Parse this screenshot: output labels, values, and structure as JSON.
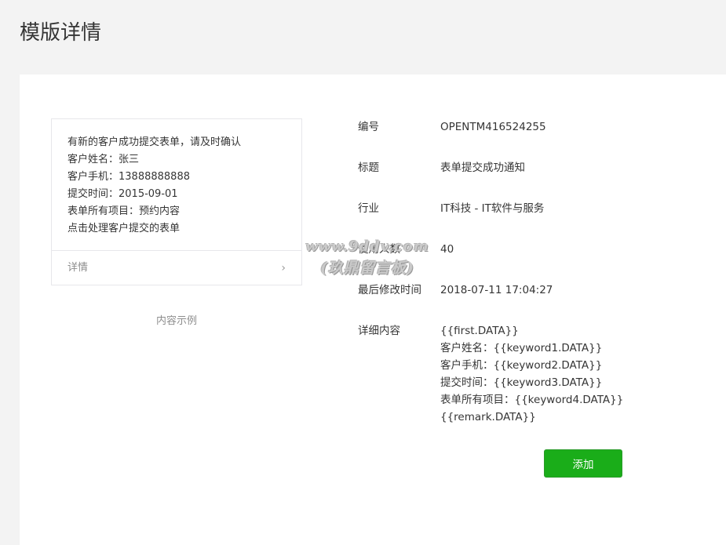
{
  "page": {
    "title": "模版详情"
  },
  "preview": {
    "lines": [
      "有新的客户成功提交表单，请及时确认",
      "客户姓名：张三",
      "客户手机：13888888888",
      "提交时间：2015-09-01",
      "表单所有项目：预约内容",
      "点击处理客户提交的表单"
    ],
    "footer_label": "详情",
    "footer_chevron": "›",
    "caption": "内容示例"
  },
  "info": {
    "id_label": "编号",
    "id_value": "OPENTM416524255",
    "title_label": "标题",
    "title_value": "表单提交成功通知",
    "industry_label": "行业",
    "industry_value": "IT科技 - IT软件与服务",
    "users_label": "使用人数",
    "users_value": "40",
    "modified_label": "最后修改时间",
    "modified_value": "2018-07-11 17:04:27",
    "detail_label": "详细内容",
    "detail_lines": [
      "{{first.DATA}}",
      "客户姓名：{{keyword1.DATA}}",
      "客户手机：{{keyword2.DATA}}",
      "提交时间：{{keyword3.DATA}}",
      "表单所有项目：{{keyword4.DATA}}",
      "{{remark.DATA}}"
    ]
  },
  "actions": {
    "add_label": "添加"
  },
  "watermark": {
    "line1": "www.9ddv.com",
    "line2": "(玖鼎留言板)"
  },
  "colors": {
    "primary_green": "#1aad19",
    "page_bg": "#f3f3f3",
    "card_bg": "#ffffff",
    "border": "#e7e7eb",
    "muted_text": "#8d8d8d"
  },
  "icons": {
    "footer_chevron": "chevron-right-icon"
  }
}
